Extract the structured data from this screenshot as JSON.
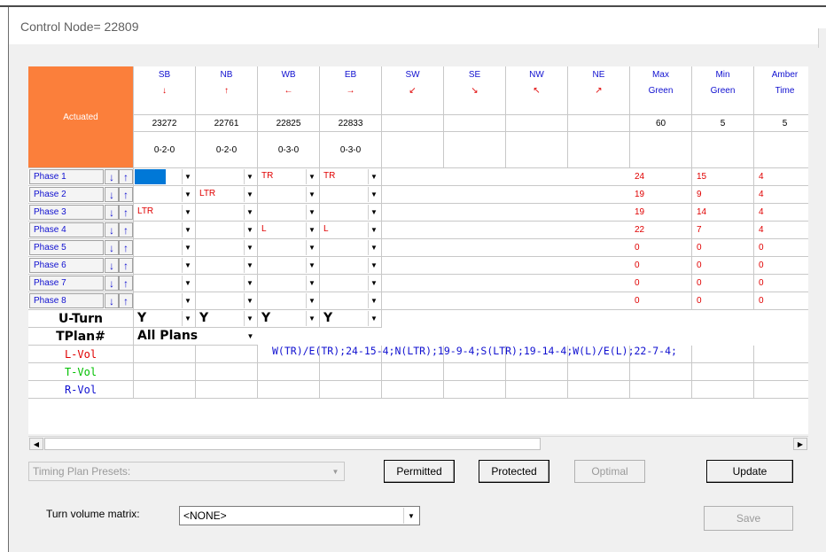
{
  "window": {
    "title": "Control Node= 22809"
  },
  "header": {
    "corner_label": "Actuated",
    "directions": [
      {
        "name": "SB",
        "arrow": "↓",
        "node": "23272",
        "lanes": "0-2-0"
      },
      {
        "name": "NB",
        "arrow": "↑",
        "node": "22761",
        "lanes": "0-2-0"
      },
      {
        "name": "WB",
        "arrow": "←",
        "node": "22825",
        "lanes": "0-3-0"
      },
      {
        "name": "EB",
        "arrow": "→",
        "node": "22833",
        "lanes": "0-3-0"
      },
      {
        "name": "SW",
        "arrow": "↙",
        "node": "",
        "lanes": ""
      },
      {
        "name": "SE",
        "arrow": "↘",
        "node": "",
        "lanes": ""
      },
      {
        "name": "NW",
        "arrow": "↖",
        "node": "",
        "lanes": ""
      },
      {
        "name": "NE",
        "arrow": "↗",
        "node": "",
        "lanes": ""
      }
    ],
    "timing_cols": [
      {
        "line1": "Max",
        "line2": "Green",
        "value": "60"
      },
      {
        "line1": "Min",
        "line2": "Green",
        "value": "5"
      },
      {
        "line1": "Amber",
        "line2": "Time",
        "value": "5"
      }
    ]
  },
  "phases": [
    {
      "label": "Phase 1",
      "movements": [
        "",
        "",
        "TR",
        "TR"
      ],
      "max": "24",
      "min": "15",
      "amber": "4"
    },
    {
      "label": "Phase 2",
      "movements": [
        "",
        "LTR",
        "",
        ""
      ],
      "max": "19",
      "min": "9",
      "amber": "4"
    },
    {
      "label": "Phase 3",
      "movements": [
        "LTR",
        "",
        "",
        ""
      ],
      "max": "19",
      "min": "14",
      "amber": "4"
    },
    {
      "label": "Phase 4",
      "movements": [
        "",
        "",
        "L",
        "L"
      ],
      "max": "22",
      "min": "7",
      "amber": "4"
    },
    {
      "label": "Phase 5",
      "movements": [
        "",
        "",
        "",
        ""
      ],
      "max": "0",
      "min": "0",
      "amber": "0"
    },
    {
      "label": "Phase 6",
      "movements": [
        "",
        "",
        "",
        ""
      ],
      "max": "0",
      "min": "0",
      "amber": "0"
    },
    {
      "label": "Phase 7",
      "movements": [
        "",
        "",
        "",
        ""
      ],
      "max": "0",
      "min": "0",
      "amber": "0"
    },
    {
      "label": "Phase 8",
      "movements": [
        "",
        "",
        "",
        ""
      ],
      "max": "0",
      "min": "0",
      "amber": "0"
    }
  ],
  "arrows": {
    "down": "↓",
    "up": "↑",
    "dropdown": "▼",
    "left": "◀",
    "right": "▶"
  },
  "uturn": {
    "label": "U-Turn",
    "values": [
      "Y",
      "Y",
      "Y",
      "Y"
    ]
  },
  "tplan": {
    "label": "TPlan#",
    "selected": "All Plans",
    "plan_string": "W(TR)/E(TR);24-15-4;N(LTR);19-9-4;S(LTR);19-14-4;W(L)/E(L);22-7-4;"
  },
  "volume_rows": [
    {
      "label": "L-Vol",
      "color": "#e00000"
    },
    {
      "label": "T-Vol",
      "color": "#00c000"
    },
    {
      "label": "R-Vol",
      "color": "#1010d0"
    }
  ],
  "controls": {
    "timing_presets_placeholder": "Timing Plan Presets:",
    "permitted": "Permitted",
    "protected": "Protected",
    "optimal": "Optimal",
    "update": "Update",
    "turn_volume_label": "Turn volume matrix:",
    "turn_volume_value": "<NONE>",
    "save": "Save"
  },
  "colors": {
    "actuated_bg": "#fb7f3b",
    "header_blue": "#1010d0",
    "value_red": "#e00000"
  }
}
